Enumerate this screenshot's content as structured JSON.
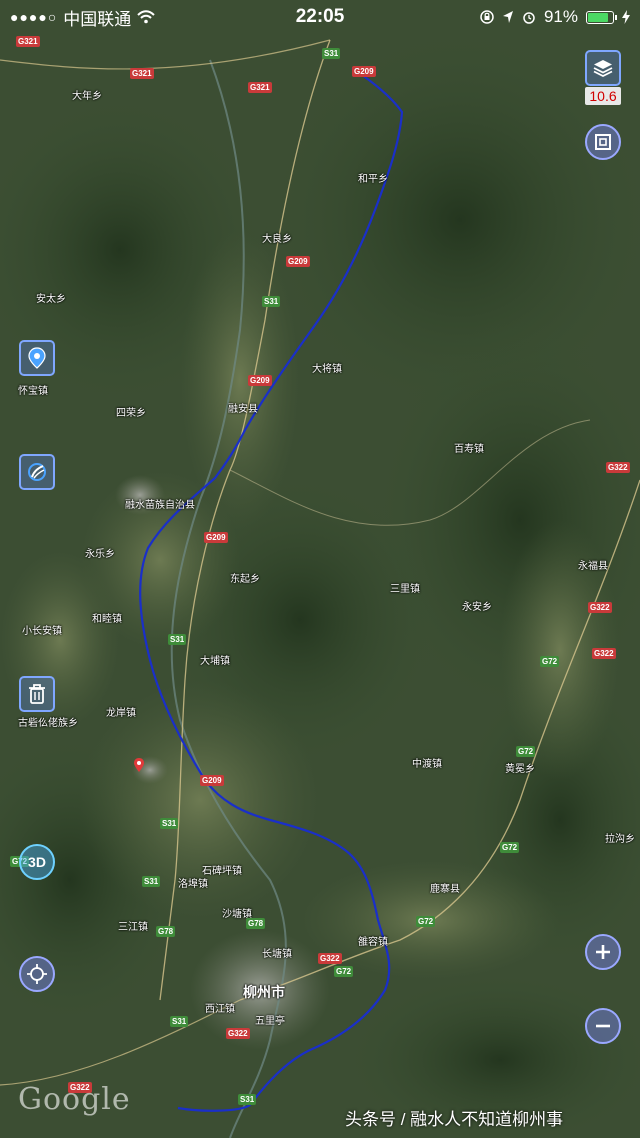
{
  "status_bar": {
    "carrier": "中国联通",
    "time": "22:05",
    "battery_percent": "91%",
    "battery_level": 0.91
  },
  "map": {
    "zoom_level": "10.6",
    "cities": [
      {
        "name": "柳州市",
        "id": "liuzhou"
      }
    ],
    "places": [
      "融水苗族自治县",
      "三江镇",
      "永乐乡",
      "和睦镇",
      "东起乡",
      "长塘镇",
      "沙塘镇",
      "石碑坪镇",
      "洛埠镇",
      "雒容镇",
      "中渡镇",
      "永福县",
      "百寿镇",
      "融安县",
      "大将镇",
      "和平乡",
      "大良乡",
      "四荣乡",
      "安太乡",
      "西江镇",
      "五里亭",
      "鹿寨县",
      "拉沟乡",
      "永安乡",
      "三里镇",
      "大埔镇",
      "龙岸镇",
      "怀宝镇",
      "黄冕乡",
      "古砦仫佬族乡",
      "小长安镇",
      "大年乡"
    ],
    "roads": [
      "G209",
      "G321",
      "S31",
      "G72",
      "G78",
      "G322"
    ],
    "route_color": "#1a2fc9"
  },
  "controls": {
    "layers_icon": "layers-icon",
    "fullscreen_icon": "fullscreen-icon",
    "location_pin_icon": "location-pin-icon",
    "compass_icon": "compass-icon",
    "trash_icon": "trash-icon",
    "three_d_label": "3D",
    "locate_icon": "crosshair-icon",
    "zoom_in_icon": "plus-icon",
    "zoom_out_icon": "minus-icon"
  },
  "attribution": "Google",
  "watermark": "头条号 / 融水人不知道柳州事"
}
